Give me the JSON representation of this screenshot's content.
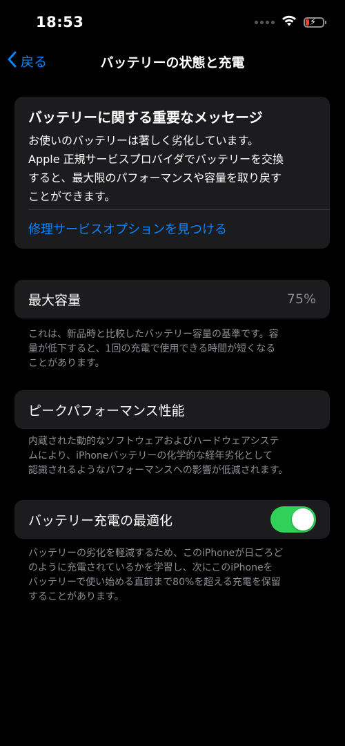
{
  "status_bar": {
    "time": "18:53",
    "battery_color": "#ff3b30"
  },
  "nav": {
    "back_label": "戻る",
    "title": "バッテリーの状態と充電"
  },
  "message_card": {
    "title": "バッテリーに関する重要なメッセージ",
    "body_lines": [
      "お使いのバッテリーは著しく劣化しています。",
      "Apple 正規サービスプロバイダでバッテリーを交換",
      "すると、最大限のパフォーマンスや容量を取り戻す",
      "ことができます。"
    ],
    "link": "修理サービスオプションを見つける"
  },
  "max_capacity": {
    "label": "最大容量",
    "value": "75%",
    "footnote_lines": [
      "これは、新品時と比較したバッテリー容量の基準です。容",
      "量が低下すると、1回の充電で使用できる時間が短くなる",
      "ことがあります。"
    ]
  },
  "peak_performance": {
    "label": "ピークパフォーマンス性能",
    "footnote_lines": [
      "内蔵された動的なソフトウェアおよびハードウェアシステ",
      "ムにより、iPhoneバッテリーの化学的な経年劣化として",
      "認識されるようなパフォーマンスへの影響が低減されます。"
    ]
  },
  "optimized_charging": {
    "label": "バッテリー充電の最適化",
    "enabled": true,
    "toggle_color": "#30d158",
    "footnote_lines": [
      "バッテリーの劣化を軽減するため、このiPhoneが日ごろど",
      "のように充電されているかを学習し、次にこのiPhoneを",
      "バッテリーで使い始める直前まで80%を超える充電を保留",
      "することがあります。"
    ]
  },
  "colors": {
    "accent": "#0a84ff",
    "card_bg": "#1c1c1e",
    "secondary_text": "#8e8e93"
  }
}
